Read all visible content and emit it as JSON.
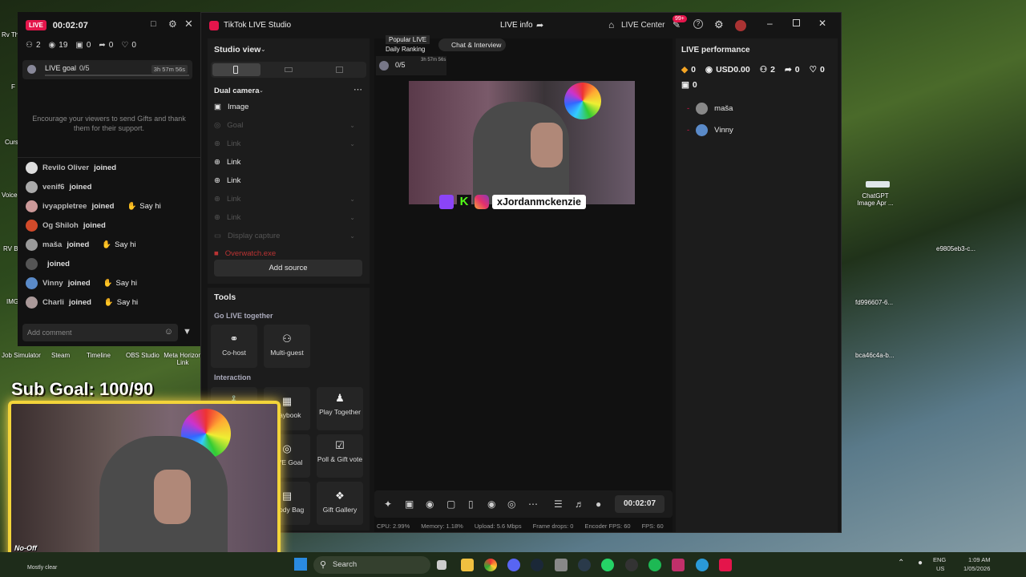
{
  "chat": {
    "live_badge": "LIVE",
    "timer": "00:02:07",
    "stats": {
      "viewers": "2",
      "views": "19",
      "gifts": "0",
      "shares": "0",
      "likes": "0"
    },
    "goal": {
      "label": "LIVE goal",
      "progress": "0/5",
      "time": "3h 57m 56s"
    },
    "encourage": "Encourage your viewers to send Gifts and thank them for their support.",
    "events": [
      {
        "name": "Revilo Oliver",
        "action": "joined",
        "sayhi": ""
      },
      {
        "name": "venif6",
        "action": "joined",
        "sayhi": ""
      },
      {
        "name": "ivyappletree",
        "action": "joined",
        "sayhi": "Say hi"
      },
      {
        "name": "Og Shiloh",
        "action": "joined",
        "sayhi": ""
      },
      {
        "name": "maša",
        "action": "joined",
        "sayhi": "Say hi"
      },
      {
        "name": "",
        "action": "joined",
        "sayhi": ""
      },
      {
        "name": "Vinny",
        "action": "joined",
        "sayhi": "Say hi"
      },
      {
        "name": "Charli",
        "action": "joined",
        "sayhi": "Say hi"
      }
    ],
    "comment_placeholder": "Add comment"
  },
  "studio": {
    "app_title": "TikTok LIVE Studio",
    "live_info": "LIVE info",
    "live_center": "LIVE Center",
    "notif_badge": "99+",
    "studio_view": "Studio view",
    "dual_camera": "Dual camera",
    "sources": [
      {
        "label": "Image",
        "dim": false
      },
      {
        "label": "Goal",
        "dim": true
      },
      {
        "label": "Link",
        "dim": true
      },
      {
        "label": "Link",
        "dim": false
      },
      {
        "label": "Link",
        "dim": false
      },
      {
        "label": "Link",
        "dim": true
      },
      {
        "label": "Link",
        "dim": true
      },
      {
        "label": "Display capture",
        "dim": true
      },
      {
        "label": "Overwatch.exe",
        "dim": true
      }
    ],
    "add_source": "Add source",
    "tools": "Tools",
    "go_live_together": "Go LIVE together",
    "cohost": "Co-host",
    "multiguest": "Multi-guest",
    "interaction": "Interaction",
    "playbook": "Playbook",
    "play_together": "Play Together",
    "live_goal": "LIVE Goal",
    "poll": "Poll & Gift vote",
    "goody_bag": "Goody Bag",
    "gift_gallery": "Gift Gallery",
    "popular_live": "Popular LIVE",
    "daily_ranking": "Daily Ranking",
    "chat_interview": "Chat & Interview",
    "preview_goal": "0/5",
    "preview_time": "3h 57m 56s",
    "overlay_handle": "xJordanmckenzie",
    "timer": "00:02:07",
    "perf_title": "LIVE performance",
    "perf": {
      "diamonds": "0",
      "usd": "USD0.00",
      "viewers": "2",
      "shares": "0",
      "likes": "0",
      "gifts": "0"
    },
    "perf_users": [
      "maša",
      "Vinny"
    ],
    "bottom_stats": {
      "cpu": "CPU: 2.99%",
      "memory": "Memory: 1.18%",
      "upload": "Upload: 5.6 Mbps",
      "drops": "Frame drops: 0",
      "enc": "Encoder FPS: 60",
      "fps": "FPS: 60"
    }
  },
  "desktop": {
    "labels": [
      "Rv Th",
      "F",
      "Curs",
      "Voice",
      "RV B",
      "IMG",
      "Job Simulator",
      "Steam",
      "Timeline",
      "OBS Studio",
      "Meta Horizon Link",
      "ChatGPT Image Apr ...",
      "e9805eb3-c...",
      "fd996607-6...",
      "bca46c4a-b..."
    ],
    "sub_goal": "Sub Goal: 100/90",
    "no_off_switch": "No-Off Switch",
    "weather": "Mostly clear"
  },
  "taskbar": {
    "search": "Search",
    "lang": "ENG",
    "region": "US",
    "time": "1:09 AM",
    "date": "1/05/2026"
  }
}
